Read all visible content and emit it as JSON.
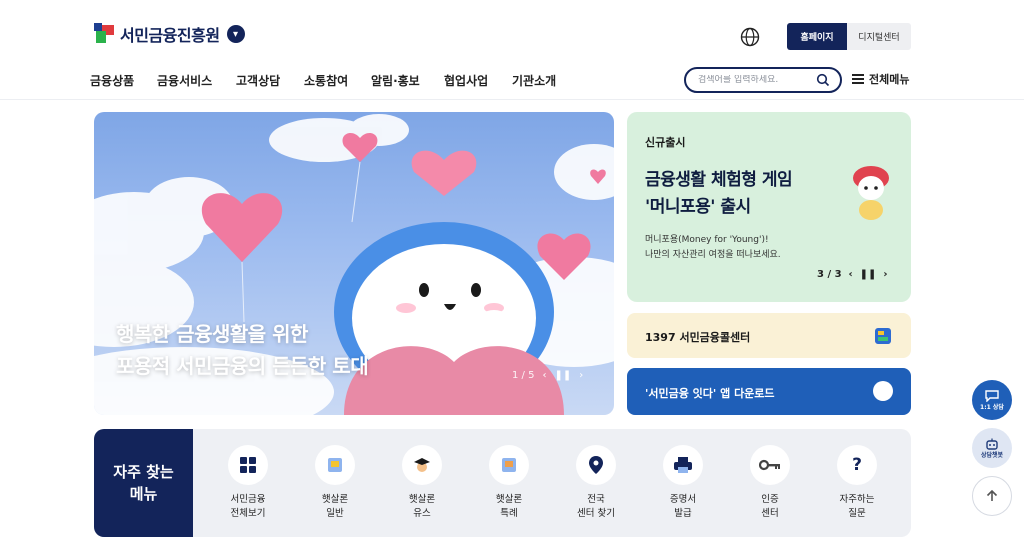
{
  "header": {
    "logo_text": "서민금융진흥원",
    "home_label": "홈페이지",
    "digital_label": "디지털센터"
  },
  "nav": {
    "items": [
      "금융상품",
      "금융서비스",
      "고객상담",
      "소통참여",
      "알림·홍보",
      "협업사업",
      "기관소개"
    ],
    "search_placeholder": "검색어를 입력하세요.",
    "all_menu": "전체메뉴"
  },
  "hero": {
    "line1": "행복한 금융생활을 위한",
    "line2": "포용적 서민금융의 든든한 토대",
    "page": "1 / 5"
  },
  "news": {
    "tag": "신규출시",
    "title_line1": "금융생활 체험형 게임",
    "title_line2": "'머니포용' 출시",
    "desc_line1": "머니포용(Money for 'Young')!",
    "desc_line2": "나만의 자산관리 여정을 떠나보세요.",
    "page": "3 / 3"
  },
  "call_center": {
    "label": "1397 서민금융콜센터"
  },
  "app_download": {
    "label": "'서민금융 잇다' 앱 다운로드"
  },
  "quick_menu": {
    "heading_line1": "자주 찾는",
    "heading_line2": "메뉴",
    "items": [
      {
        "line1": "서민금융",
        "line2": "전체보기",
        "icon": "grid-icon"
      },
      {
        "line1": "햇살론",
        "line2": "일반",
        "icon": "document-icon"
      },
      {
        "line1": "햇살론",
        "line2": "유스",
        "icon": "graduate-icon"
      },
      {
        "line1": "햇살론",
        "line2": "특례",
        "icon": "document-icon"
      },
      {
        "line1": "전국",
        "line2": "센터 찾기",
        "icon": "location-pin-icon"
      },
      {
        "line1": "증명서",
        "line2": "발급",
        "icon": "printer-icon"
      },
      {
        "line1": "인증",
        "line2": "센터",
        "icon": "key-icon"
      },
      {
        "line1": "자주하는",
        "line2": "질문",
        "icon": "question-icon"
      }
    ]
  },
  "floating": {
    "chat_label": "1:1 상담",
    "bot_label": "상담챗봇"
  },
  "colors": {
    "navy": "#13245a",
    "blue": "#1f5fb8",
    "mint": "#d8f0dd",
    "cream": "#faf1d6"
  }
}
